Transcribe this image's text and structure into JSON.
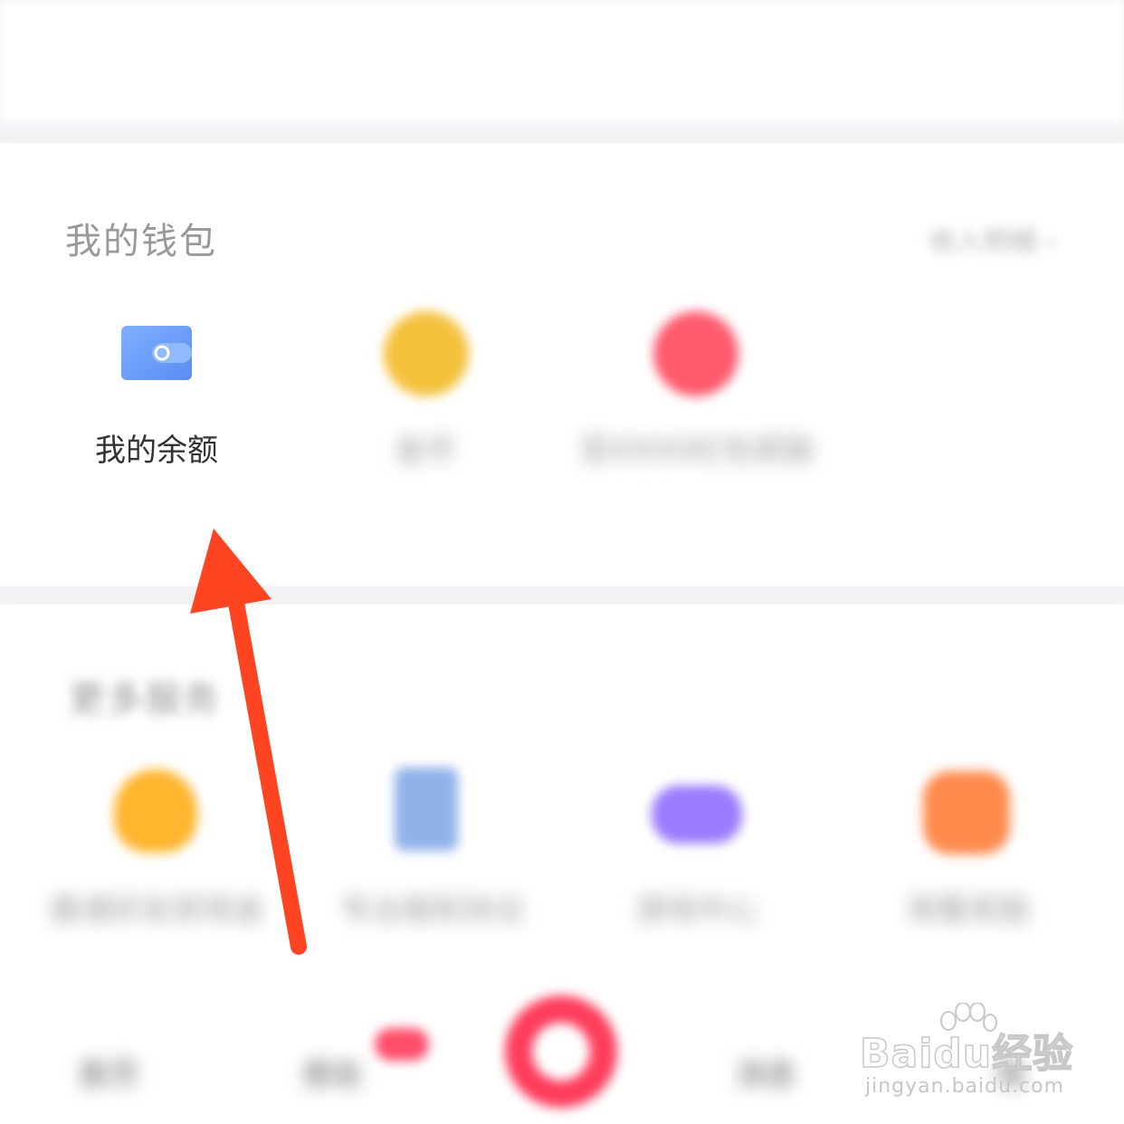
{
  "wallet": {
    "title": "我的钱包",
    "header_link": "收入明细",
    "items": [
      {
        "label": "我的余额",
        "icon": "wallet-icon"
      },
      {
        "label": "金币",
        "icon": "coin-icon"
      },
      {
        "label": "至IOOO红包奖励",
        "icon": "red-packet-icon"
      }
    ]
  },
  "more_services": {
    "title": "更多服务",
    "items": [
      {
        "label": "邀请好友奖现金",
        "icon": "medal-icon"
      },
      {
        "label": "专业版权协议",
        "icon": "document-icon"
      },
      {
        "label": "游戏中心",
        "icon": "gamepad-icon"
      },
      {
        "label": "观看奖励",
        "icon": "gift-box-icon"
      }
    ]
  },
  "tabbar": {
    "items": [
      {
        "label": "首页"
      },
      {
        "label": "朋友"
      },
      {
        "label": "消息"
      },
      {
        "label": "我"
      }
    ]
  },
  "colors": {
    "arrow": "#ff4422",
    "wallet_icon_blue": "#6ea0ff",
    "coin_yellow": "#f4c13c",
    "red_packet": "#ff5a6e",
    "game_purple": "#9b7bff",
    "gift_orange": "#ff8a4c",
    "center_button": "#ff3c5c"
  },
  "watermark": {
    "brand": "Baidu经验",
    "url": "jingyan.baidu.com"
  }
}
